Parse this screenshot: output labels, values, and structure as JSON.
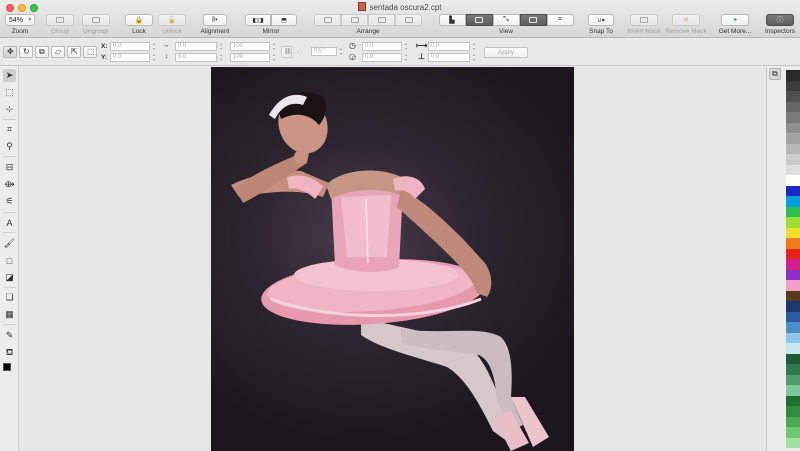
{
  "window": {
    "title": "sentada oscura2.cpt"
  },
  "toolbar": {
    "zoom": {
      "value": "54%",
      "label": "Zoom"
    },
    "group_label": "Group",
    "ungroup_label": "Ungroup",
    "lock_label": "Lock",
    "unlock_label": "Unlock",
    "alignment_label": "Alignment",
    "mirror_label": "Mirror",
    "arrange_label": "Arrange",
    "view_label": "View",
    "snap_label": "Snap To",
    "invert_mask_label": "Invert Mask",
    "remove_mask_label": "Remove Mask",
    "get_more_label": "Get More...",
    "inspectors_label": "Inspectors"
  },
  "controlbar": {
    "x_label": "X:",
    "y_label": "Y:",
    "x_value": "0.0",
    "y_value": "0.0",
    "w_value": "0.0",
    "h_value": "0.0",
    "scale_w_value": "100",
    "scale_h_value": "100",
    "angle_value": "0.0 °",
    "skew1_value": "0.0",
    "skew2_value": "0.0",
    "pos_w_value": "0.0",
    "pos_h_value": "0.0",
    "apply_label": "Apply"
  },
  "palette": {
    "colors": [
      "#2a2a2a",
      "#3d3d3d",
      "#505050",
      "#666666",
      "#7b7b7b",
      "#8f8f8f",
      "#a3a3a3",
      "#b7b7b7",
      "#cbcbcb",
      "#dfdfdf",
      "#ffffff",
      "#1a28c8",
      "#00a0e0",
      "#2ec04e",
      "#9ee02e",
      "#f0e02a",
      "#f07a1e",
      "#e8201e",
      "#d81e8e",
      "#8e2ec8",
      "#f0a0c8",
      "#5a3a1e",
      "#1a3a6e",
      "#2e5a9e",
      "#4e8ec8",
      "#8ec8e8",
      "#c8e8f0",
      "#1e5a3a",
      "#2e7a4e",
      "#4e9e6e",
      "#7ec89e",
      "#1e6e2e",
      "#2e8e3e",
      "#4ea84e",
      "#6ec86e",
      "#9ee09e"
    ]
  }
}
